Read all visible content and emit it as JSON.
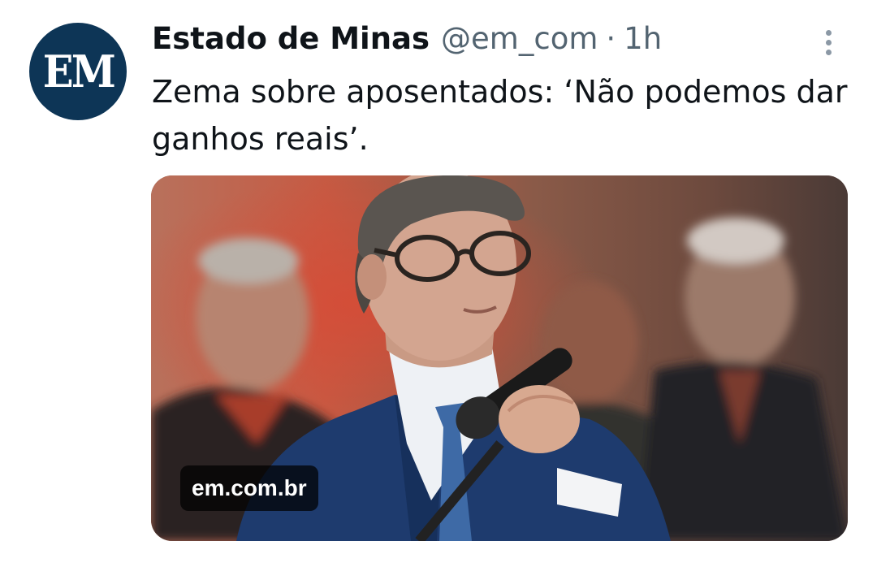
{
  "tweet": {
    "avatar_text": "EM",
    "author_name": "Estado de Minas",
    "handle": "@em_com",
    "separator": "·",
    "time": "1h",
    "text": "Zema sobre aposentados: ‘Não podemos dar ganhos reais’.",
    "link_card": {
      "domain": "em.com.br"
    }
  },
  "colors": {
    "avatar_bg": "#0d3556",
    "primary_text": "#0f1419",
    "secondary_text": "#536471"
  },
  "icons": {
    "more": "more-vertical-icon"
  }
}
